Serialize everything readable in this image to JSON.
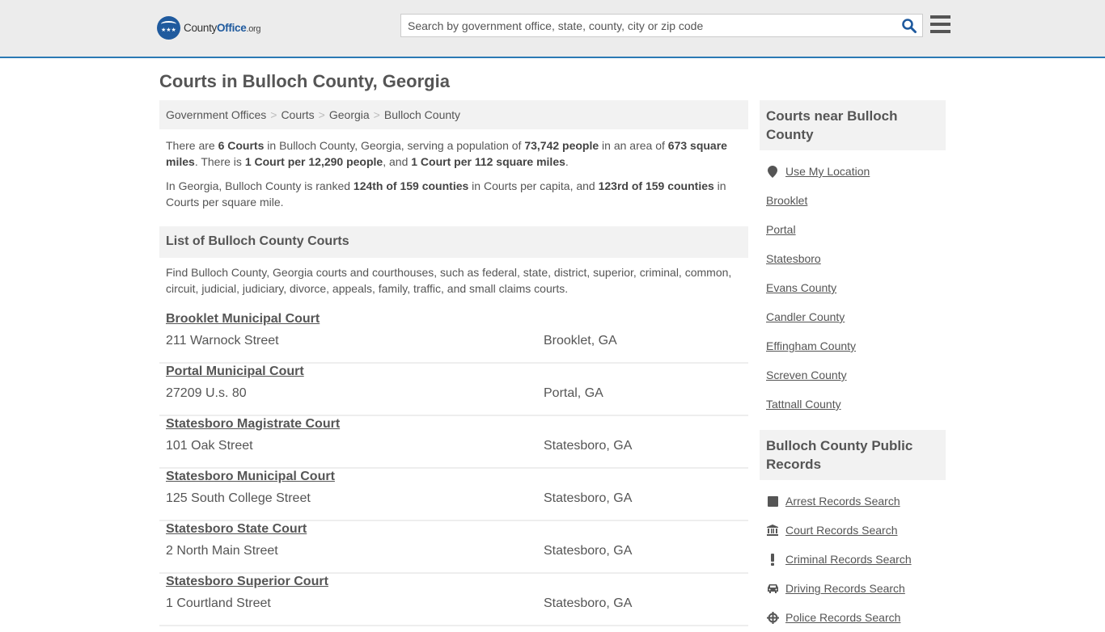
{
  "header": {
    "logo": {
      "prefix": "County",
      "brand": "Office",
      "suffix": ".org"
    },
    "search_placeholder": "Search by government office, state, county, city or zip code",
    "search_value": ""
  },
  "page_title": "Courts in Bulloch County, Georgia",
  "breadcrumb": [
    "Government Offices",
    "Courts",
    "Georgia",
    "Bulloch County"
  ],
  "breadcrumb_separator": ">",
  "intro": {
    "p1": [
      {
        "t": "There are ",
        "b": false
      },
      {
        "t": "6 Courts",
        "b": true
      },
      {
        "t": " in Bulloch County, Georgia, serving a population of ",
        "b": false
      },
      {
        "t": "73,742 people",
        "b": true
      },
      {
        "t": " in an area of ",
        "b": false
      },
      {
        "t": "673 square miles",
        "b": true
      },
      {
        "t": ". There is ",
        "b": false
      },
      {
        "t": "1 Court per 12,290 people",
        "b": true
      },
      {
        "t": ", and ",
        "b": false
      },
      {
        "t": "1 Court per 112 square miles",
        "b": true
      },
      {
        "t": ".",
        "b": false
      }
    ],
    "p2": [
      {
        "t": "In Georgia, Bulloch County is ranked ",
        "b": false
      },
      {
        "t": "124th of 159 counties",
        "b": true
      },
      {
        "t": " in Courts per capita, and ",
        "b": false
      },
      {
        "t": "123rd of 159 counties",
        "b": true
      },
      {
        "t": " in Courts per square mile.",
        "b": false
      }
    ]
  },
  "list_section": {
    "title": "List of Bulloch County Courts",
    "description": "Find Bulloch County, Georgia courts and courthouses, such as federal, state, district, superior, criminal, common, circuit, judicial, judiciary, divorce, appeals, family, traffic, and small claims courts."
  },
  "courts": [
    {
      "name": "Brooklet Municipal Court",
      "address": "211 Warnock Street",
      "city": "Brooklet, GA"
    },
    {
      "name": "Portal Municipal Court",
      "address": "27209 U.s. 80",
      "city": "Portal, GA"
    },
    {
      "name": "Statesboro Magistrate Court",
      "address": "101 Oak Street",
      "city": "Statesboro, GA"
    },
    {
      "name": "Statesboro Municipal Court",
      "address": "125 South College Street",
      "city": "Statesboro, GA"
    },
    {
      "name": "Statesboro State Court",
      "address": "2 North Main Street",
      "city": "Statesboro, GA"
    },
    {
      "name": "Statesboro Superior Court",
      "address": "1 Courtland Street",
      "city": "Statesboro, GA"
    }
  ],
  "sidebar": {
    "nearby": {
      "title": "Courts near Bulloch County",
      "use_location": {
        "label": "Use My Location",
        "icon": "map-pin-icon"
      },
      "links": [
        "Brooklet",
        "Portal",
        "Statesboro",
        "Evans County",
        "Candler County",
        "Effingham County",
        "Screven County",
        "Tattnall County"
      ]
    },
    "records": {
      "title": "Bulloch County Public Records",
      "links": [
        {
          "label": "Arrest Records Search",
          "icon": "square-icon"
        },
        {
          "label": "Court Records Search",
          "icon": "courthouse-icon"
        },
        {
          "label": "Criminal Records Search",
          "icon": "exclamation-icon"
        },
        {
          "label": "Driving Records Search",
          "icon": "car-icon"
        },
        {
          "label": "Police Records Search",
          "icon": "crosshair-icon"
        }
      ]
    }
  },
  "colors": {
    "accent": "#2b79b4",
    "brand": "#1f5a9e",
    "text": "#555555",
    "panel": "#f2f2f2"
  }
}
